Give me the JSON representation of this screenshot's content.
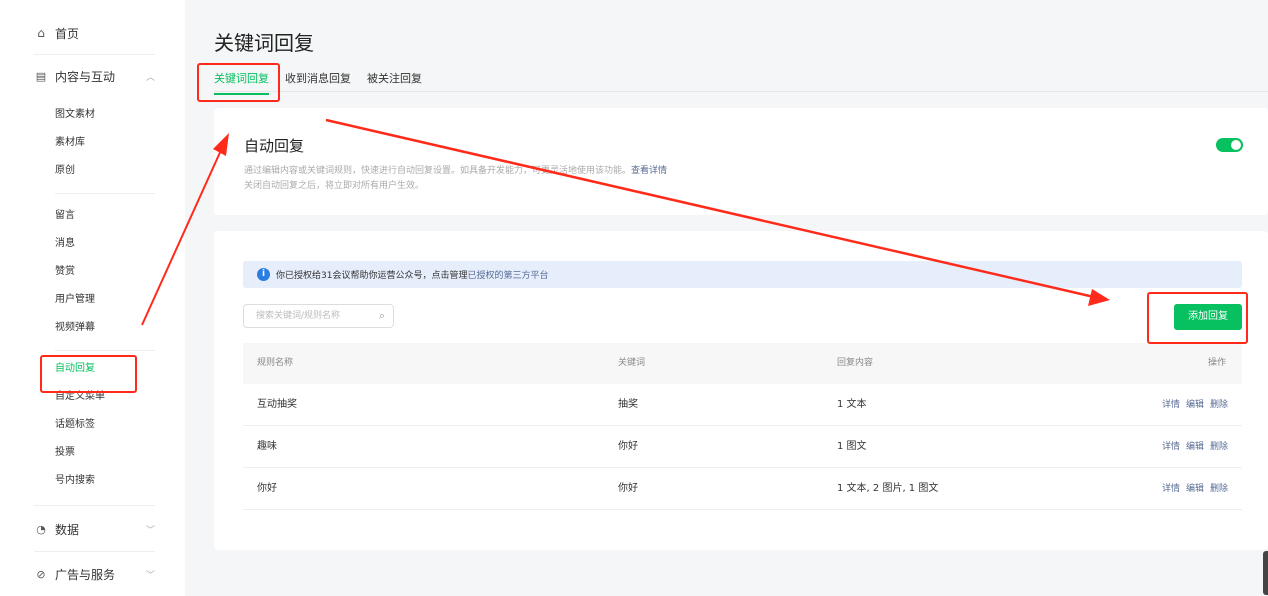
{
  "sidebar": {
    "home": {
      "label": "首页",
      "icon": "home-icon"
    },
    "content_group": {
      "label": "内容与互动",
      "icon": "document-icon",
      "chevron": "chevron-up-icon"
    },
    "content_items_a": [
      "图文素材",
      "素材库",
      "原创"
    ],
    "content_items_b": [
      "留言",
      "消息",
      "赞赏",
      "用户管理",
      "视频弹幕"
    ],
    "content_items_c": [
      "自动回复",
      "自定义菜单",
      "话题标签",
      "投票",
      "号内搜索"
    ],
    "active_item": "自动回复",
    "data_group": {
      "label": "数据",
      "icon": "clock-chart-icon",
      "chevron": "chevron-down-icon"
    },
    "ads_group": {
      "label": "广告与服务",
      "icon": "compass-icon",
      "chevron": "chevron-down-icon"
    }
  },
  "page": {
    "title": "关键词回复",
    "tabs": [
      {
        "label": "关键词回复",
        "active": true
      },
      {
        "label": "收到消息回复",
        "active": false
      },
      {
        "label": "被关注回复",
        "active": false
      }
    ]
  },
  "auto_reply": {
    "title": "自动回复",
    "desc1": "通过编辑内容或关键词规则，快速进行自动回复设置。如具备开发能力，可更灵活地使用该功能。",
    "desc1_link": "查看详情",
    "desc2": "关闭自动回复之后，将立即对所有用户生效。",
    "enabled": true
  },
  "rules": {
    "notice_text": "你已授权给31会议帮助你运营公众号，点击管理",
    "notice_link": "已授权的第三方平台",
    "search_placeholder": "搜索关键词/规则名称",
    "add_button": "添加回复",
    "columns": [
      "规则名称",
      "关键词",
      "回复内容",
      "操作"
    ],
    "rows": [
      {
        "name": "互动抽奖",
        "keyword": "抽奖",
        "content": "1 文本"
      },
      {
        "name": "趣味",
        "keyword": "你好",
        "content": "1 图文"
      },
      {
        "name": "你好",
        "keyword": "你好",
        "content": "1 文本, 2 图片, 1 图文"
      }
    ],
    "actions": [
      "详情",
      "编辑",
      "删除"
    ]
  },
  "colors": {
    "accent": "#07c160",
    "link": "#576b95",
    "annotation": "#ff2a1a"
  }
}
